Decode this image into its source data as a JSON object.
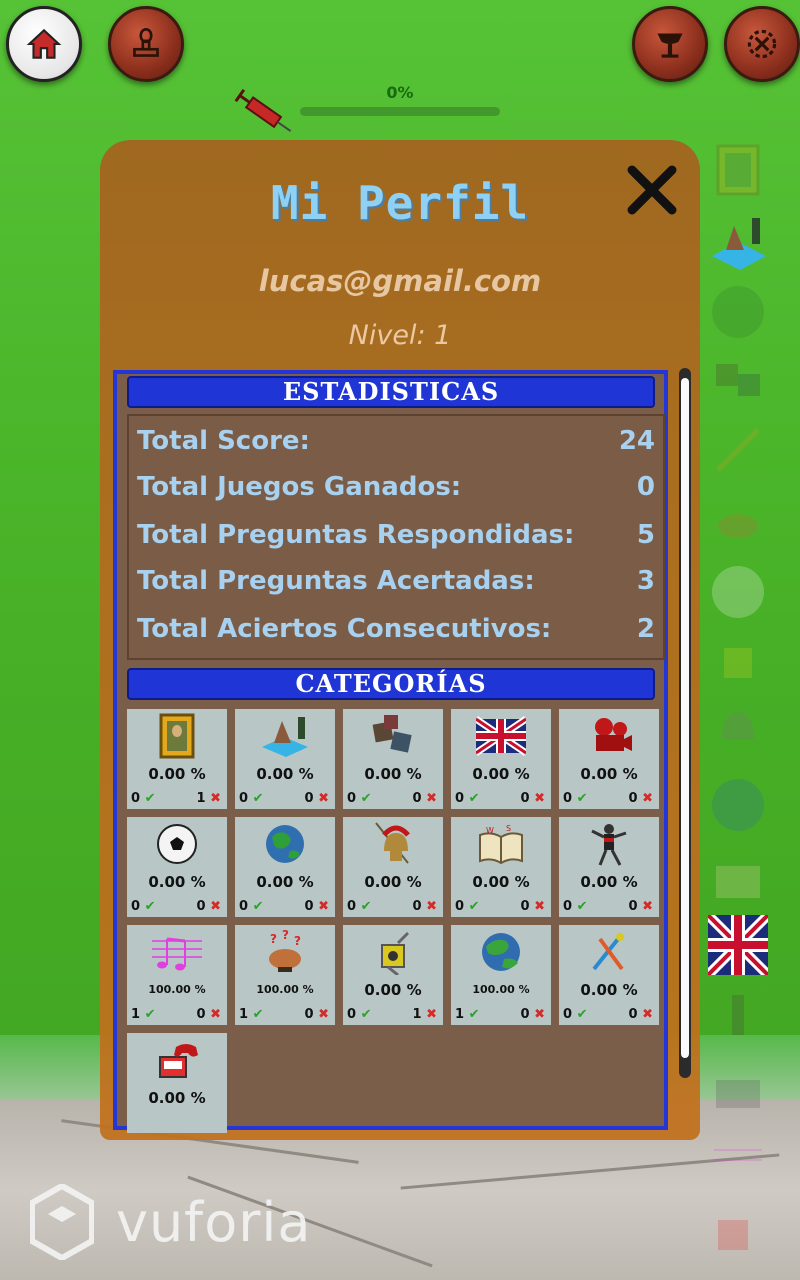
{
  "hud": {
    "progress_label": "0%",
    "progress_fraction": 0.0
  },
  "panel": {
    "title": "Mi Perfil",
    "email": "lucas@gmail.com",
    "level": "Nivel: 1"
  },
  "stats": {
    "header": "ESTADISTICAS",
    "rows": [
      {
        "label": "Total Score:",
        "value": "24"
      },
      {
        "label": "Total Juegos Ganados:",
        "value": "0"
      },
      {
        "label": "Total Preguntas Respondidas:",
        "value": "5"
      },
      {
        "label": "Total Preguntas Acertadas:",
        "value": "3"
      },
      {
        "label": "Total Aciertos Consecutivos:",
        "value": "2"
      }
    ]
  },
  "categories": {
    "header": "CATEGORÍAS",
    "items": [
      {
        "icon": "painting-icon",
        "pct": "0.00 %",
        "ok": "0",
        "ko": "1"
      },
      {
        "icon": "island-icon",
        "pct": "0.00 %",
        "ok": "0",
        "ko": "0"
      },
      {
        "icon": "cubes-icon",
        "pct": "0.00 %",
        "ok": "0",
        "ko": "0"
      },
      {
        "icon": "uk-flag-icon",
        "pct": "0.00 %",
        "ok": "0",
        "ko": "0"
      },
      {
        "icon": "cinema-icon",
        "pct": "0.00 %",
        "ok": "0",
        "ko": "0"
      },
      {
        "icon": "soccer-ball-icon",
        "pct": "0.00 %",
        "ok": "0",
        "ko": "0"
      },
      {
        "icon": "earth-icon",
        "pct": "0.00 %",
        "ok": "0",
        "ko": "0"
      },
      {
        "icon": "spartan-helmet-icon",
        "pct": "0.00 %",
        "ok": "0",
        "ko": "0"
      },
      {
        "icon": "open-book-icon",
        "pct": "0.00 %",
        "ok": "0",
        "ko": "0"
      },
      {
        "icon": "dancer-icon",
        "pct": "0.00 %",
        "ok": "0",
        "ko": "0"
      },
      {
        "icon": "music-notes-icon",
        "pct": "100.00 %",
        "ok": "1",
        "ko": "0"
      },
      {
        "icon": "brain-icon",
        "pct": "100.00 %",
        "ok": "1",
        "ko": "0"
      },
      {
        "icon": "chemistry-icon",
        "pct": "0.00 %",
        "ok": "0",
        "ko": "1"
      },
      {
        "icon": "globe-icon",
        "pct": "100.00 %",
        "ok": "1",
        "ko": "0"
      },
      {
        "icon": "science-tools-icon",
        "pct": "0.00 %",
        "ok": "0",
        "ko": "0"
      },
      {
        "icon": "videogame-icon",
        "pct": "0.00 %",
        "ok": "",
        "ko": ""
      }
    ]
  },
  "branding": {
    "logo_text": "vuforia"
  },
  "colors": {
    "panel": "#b46a1e",
    "title": "#8fd0f5",
    "section_header": "#1f35d6",
    "stat_text": "#a8d1f0",
    "check": "#27a327",
    "cross": "#d42a2a"
  }
}
